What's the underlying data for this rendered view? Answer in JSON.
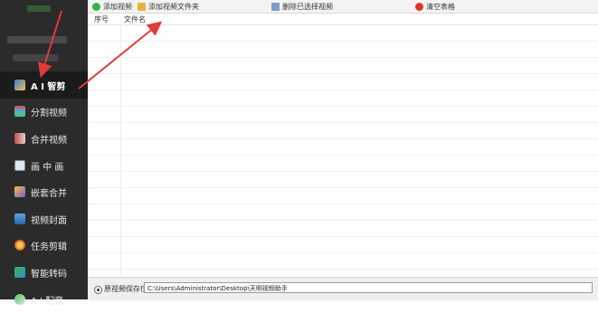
{
  "toolbar": {
    "add_video": "添加视频",
    "add_folder": "添加视频文件夹",
    "delete_selected": "删除已选择视频",
    "clear_list": "清空表格"
  },
  "table": {
    "col_index": "序号",
    "col_filename": "文件名"
  },
  "sidebar": {
    "items": [
      {
        "label": "A I 智剪",
        "icon": "scissors-icon",
        "active": true
      },
      {
        "label": "分割视频",
        "icon": "split-icon"
      },
      {
        "label": "合并视频",
        "icon": "merge-icon"
      },
      {
        "label": "画 中 画",
        "icon": "picture-in-picture-icon"
      },
      {
        "label": "嵌套合并",
        "icon": "nest-merge-icon"
      },
      {
        "label": "视频封面",
        "icon": "cover-icon"
      },
      {
        "label": "任务剪辑",
        "icon": "task-clip-icon"
      },
      {
        "label": "智能转码",
        "icon": "transcode-icon"
      },
      {
        "label": "A I 配音",
        "icon": "dubbing-icon"
      }
    ]
  },
  "bottom": {
    "save_label": "原视频保存位",
    "save_path": "C:\\Users\\Administrator\\Desktop\\天明视频助手"
  },
  "colors": {
    "sidebar_bg": "#2b2b2b",
    "sidebar_active": "#1b1b1b",
    "arrow": "#e03b3b"
  }
}
